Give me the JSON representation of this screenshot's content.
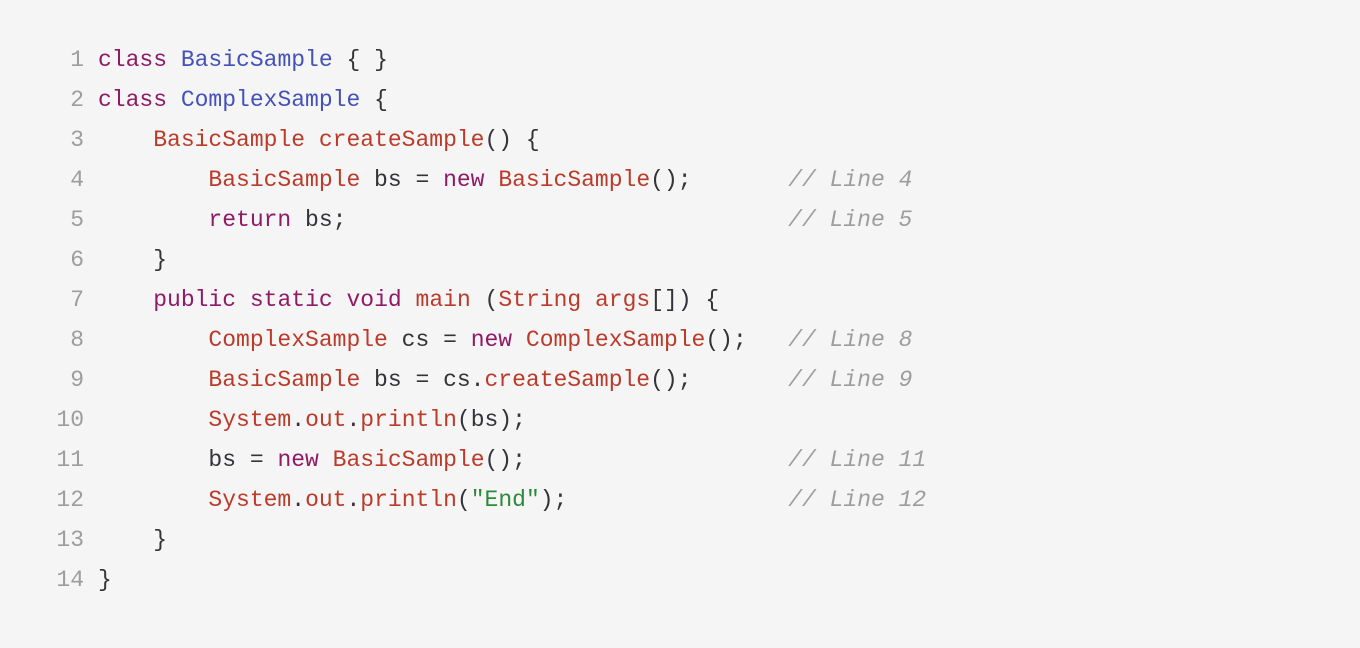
{
  "code": {
    "language": "java",
    "lines": [
      {
        "n": 1,
        "indent": 0,
        "tokens": [
          {
            "c": "k",
            "t": "class"
          },
          {
            "c": "p",
            "t": " "
          },
          {
            "c": "cls",
            "t": "BasicSample"
          },
          {
            "c": "p",
            "t": " { }"
          }
        ]
      },
      {
        "n": 2,
        "indent": 0,
        "tokens": [
          {
            "c": "k",
            "t": "class"
          },
          {
            "c": "p",
            "t": " "
          },
          {
            "c": "cls",
            "t": "ComplexSample"
          },
          {
            "c": "p",
            "t": " {"
          }
        ]
      },
      {
        "n": 3,
        "indent": 1,
        "tokens": [
          {
            "c": "t",
            "t": "BasicSample"
          },
          {
            "c": "p",
            "t": " "
          },
          {
            "c": "t",
            "t": "createSample"
          },
          {
            "c": "p",
            "t": "() {"
          }
        ]
      },
      {
        "n": 4,
        "indent": 2,
        "comment": "// Line 4",
        "tokens": [
          {
            "c": "t",
            "t": "BasicSample"
          },
          {
            "c": "p",
            "t": " bs = "
          },
          {
            "c": "k",
            "t": "new"
          },
          {
            "c": "p",
            "t": " "
          },
          {
            "c": "t",
            "t": "BasicSample"
          },
          {
            "c": "p",
            "t": "();"
          }
        ]
      },
      {
        "n": 5,
        "indent": 2,
        "comment": "// Line 5",
        "tokens": [
          {
            "c": "k",
            "t": "return"
          },
          {
            "c": "p",
            "t": " bs;"
          }
        ]
      },
      {
        "n": 6,
        "indent": 1,
        "tokens": [
          {
            "c": "p",
            "t": "}"
          }
        ]
      },
      {
        "n": 7,
        "indent": 1,
        "tokens": [
          {
            "c": "k",
            "t": "public"
          },
          {
            "c": "p",
            "t": " "
          },
          {
            "c": "k",
            "t": "static"
          },
          {
            "c": "p",
            "t": " "
          },
          {
            "c": "k",
            "t": "void"
          },
          {
            "c": "p",
            "t": " "
          },
          {
            "c": "t",
            "t": "main"
          },
          {
            "c": "p",
            "t": " ("
          },
          {
            "c": "t",
            "t": "String"
          },
          {
            "c": "p",
            "t": " "
          },
          {
            "c": "t",
            "t": "args"
          },
          {
            "c": "p",
            "t": "[]) {"
          }
        ]
      },
      {
        "n": 8,
        "indent": 2,
        "comment": "// Line 8",
        "tokens": [
          {
            "c": "t",
            "t": "ComplexSample"
          },
          {
            "c": "p",
            "t": " cs = "
          },
          {
            "c": "k",
            "t": "new"
          },
          {
            "c": "p",
            "t": " "
          },
          {
            "c": "t",
            "t": "ComplexSample"
          },
          {
            "c": "p",
            "t": "();"
          }
        ]
      },
      {
        "n": 9,
        "indent": 2,
        "comment": "// Line 9",
        "tokens": [
          {
            "c": "t",
            "t": "BasicSample"
          },
          {
            "c": "p",
            "t": " bs = cs."
          },
          {
            "c": "t",
            "t": "createSample"
          },
          {
            "c": "p",
            "t": "();"
          }
        ]
      },
      {
        "n": 10,
        "indent": 2,
        "tokens": [
          {
            "c": "t",
            "t": "System"
          },
          {
            "c": "p",
            "t": "."
          },
          {
            "c": "t",
            "t": "out"
          },
          {
            "c": "p",
            "t": "."
          },
          {
            "c": "t",
            "t": "println"
          },
          {
            "c": "p",
            "t": "(bs);"
          }
        ]
      },
      {
        "n": 11,
        "indent": 2,
        "comment": "// Line 11",
        "tokens": [
          {
            "c": "p",
            "t": "bs = "
          },
          {
            "c": "k",
            "t": "new"
          },
          {
            "c": "p",
            "t": " "
          },
          {
            "c": "t",
            "t": "BasicSample"
          },
          {
            "c": "p",
            "t": "();"
          }
        ]
      },
      {
        "n": 12,
        "indent": 2,
        "comment": "// Line 12",
        "tokens": [
          {
            "c": "t",
            "t": "System"
          },
          {
            "c": "p",
            "t": "."
          },
          {
            "c": "t",
            "t": "out"
          },
          {
            "c": "p",
            "t": "."
          },
          {
            "c": "t",
            "t": "println"
          },
          {
            "c": "p",
            "t": "("
          },
          {
            "c": "s",
            "t": "\"End\""
          },
          {
            "c": "p",
            "t": ");"
          }
        ]
      },
      {
        "n": 13,
        "indent": 1,
        "tokens": [
          {
            "c": "p",
            "t": "}"
          }
        ]
      },
      {
        "n": 14,
        "indent": 0,
        "tokens": [
          {
            "c": "p",
            "t": "}"
          }
        ]
      }
    ],
    "indent_unit": "    ",
    "comment_column": 50
  }
}
